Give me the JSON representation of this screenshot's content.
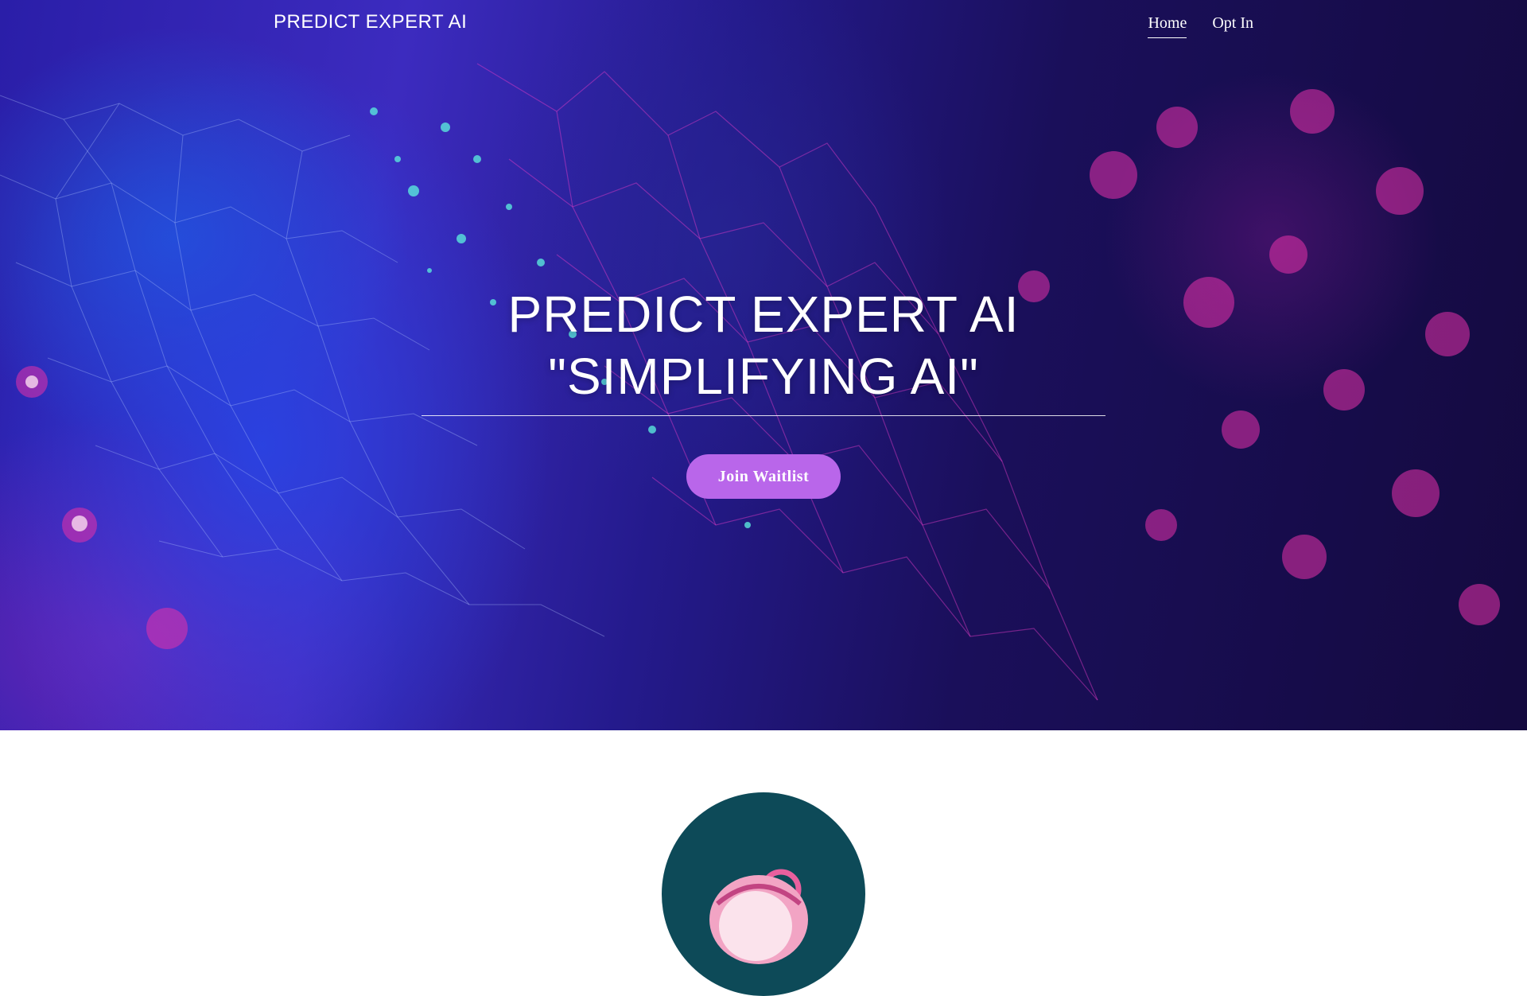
{
  "brand": {
    "name": "PREDICT EXPERT AI"
  },
  "nav": {
    "items": [
      {
        "label": "Home",
        "active": true
      },
      {
        "label": "Opt In",
        "active": false
      }
    ]
  },
  "hero": {
    "title_line1": "PREDICT EXPERT AI",
    "title_line2": "\"SIMPLIFYING AI\"",
    "cta_label": "Join Waitlist"
  },
  "colors": {
    "cta": "#b966ea",
    "text": "#ffffff",
    "avatar_bg": "#0d4a58"
  },
  "icons": {
    "avatar": "robot-avatar-icon"
  }
}
